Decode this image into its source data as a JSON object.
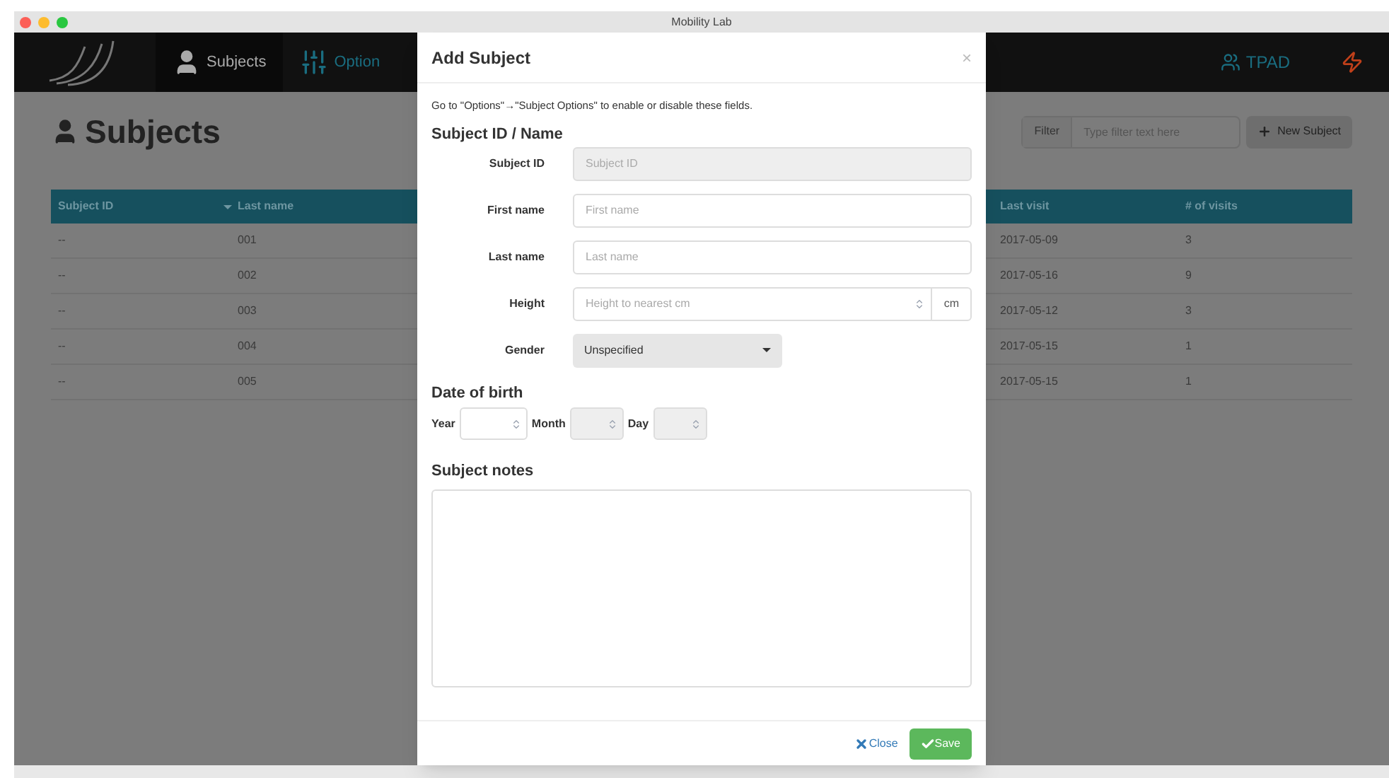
{
  "window": {
    "title": "Mobility Lab"
  },
  "navbar": {
    "tabs": [
      {
        "label": "Subjects",
        "selected": true
      },
      {
        "label": "Option",
        "selected": false
      }
    ],
    "user": "TPAD"
  },
  "page": {
    "title": "Subjects",
    "filter": {
      "label": "Filter",
      "placeholder": "Type filter text here"
    },
    "new_button": "New Subject"
  },
  "table": {
    "columns": [
      {
        "label": "Subject ID",
        "sorted": true
      },
      {
        "label": "Last name",
        "sorted": false
      },
      {
        "label": "Last visit",
        "sorted": false
      },
      {
        "label": "# of visits",
        "sorted": false
      }
    ],
    "rows": [
      [
        "--",
        "001",
        "2017-05-09",
        "3"
      ],
      [
        "--",
        "002",
        "2017-05-16",
        "9"
      ],
      [
        "--",
        "003",
        "2017-05-12",
        "3"
      ],
      [
        "--",
        "004",
        "2017-05-15",
        "1"
      ],
      [
        "--",
        "005",
        "2017-05-15",
        "1"
      ]
    ]
  },
  "modal": {
    "title": "Add Subject",
    "close_glyph": "×",
    "hint": "Go to \"Options\"→\"Subject Options\" to enable or disable these fields.",
    "section": "Subject ID / Name",
    "fields": [
      {
        "kind": "text",
        "label": "Subject ID",
        "placeholder": "Subject ID",
        "disabled": true
      },
      {
        "kind": "text",
        "label": "First name",
        "placeholder": "First name",
        "disabled": false
      },
      {
        "kind": "text",
        "label": "Last name",
        "placeholder": "Last name",
        "disabled": false
      },
      {
        "kind": "number",
        "label": "Height",
        "placeholder": "Height to nearest cm",
        "unit": "cm",
        "disabled": false
      },
      {
        "kind": "select",
        "label": "Gender",
        "value": "Unspecified",
        "disabled": false
      }
    ],
    "dob": {
      "title": "Date of birth",
      "parts": [
        {
          "label": "Year",
          "disabled": false
        },
        {
          "label": "Month",
          "disabled": true
        },
        {
          "label": "Day",
          "disabled": true
        }
      ]
    },
    "notes_title": "Subject notes",
    "close_button": "Close",
    "save_button": "Save"
  }
}
